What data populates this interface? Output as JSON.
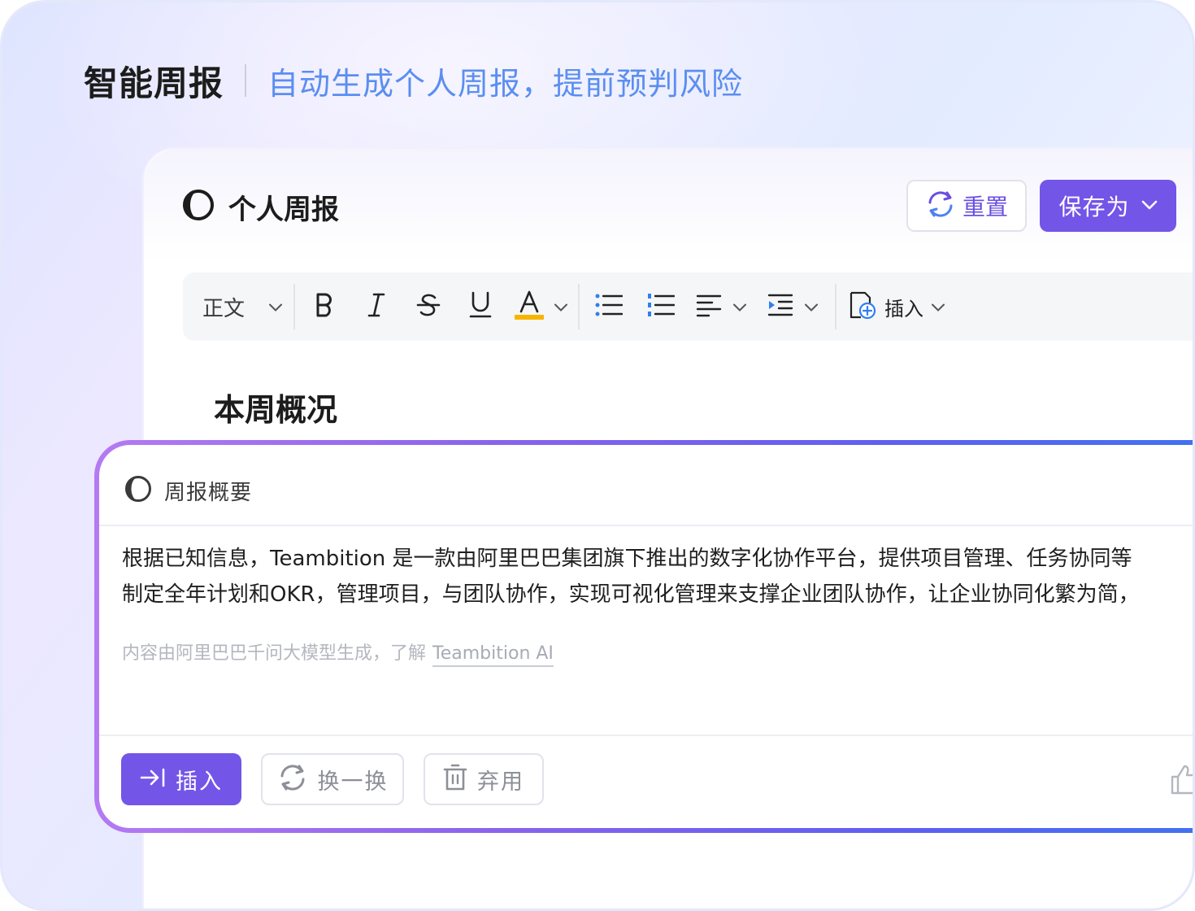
{
  "hero": {
    "title": "智能周报",
    "subtitle": "自动生成个人周报，提前预判风险"
  },
  "doc": {
    "title": "个人周报",
    "reset_label": "重置",
    "save_label": "保存为"
  },
  "toolbar": {
    "text_style": "正文",
    "insert_label": "插入",
    "icons": [
      "bold-icon",
      "italic-icon",
      "strikethrough-icon",
      "underline-icon",
      "font-color-icon",
      "bullet-list-icon",
      "numbered-list-icon",
      "align-icon",
      "indent-icon",
      "insert-icon"
    ]
  },
  "section": {
    "heading": "本周概况"
  },
  "ai_card": {
    "title": "周报概要",
    "line1": "根据已知信息，Teambition 是一款由阿里巴巴集团旗下推出的数字化协作平台，提供项目管理、任务协同等",
    "line2": "制定全年计划和OKR，管理项目，与团队协作，实现可视化管理来支撑企业团队协作，让企业协同化繁为简，",
    "note": "内容由阿里巴巴千问大模型生成，了解",
    "note_link": "Teambition AI",
    "insert_label": "插入",
    "swap_label": "换一换",
    "discard_label": "弃用"
  },
  "colors": {
    "accent": "#7355e7",
    "subtitle_blue": "#5b8ef0",
    "highlight_yellow": "#f7b500"
  }
}
